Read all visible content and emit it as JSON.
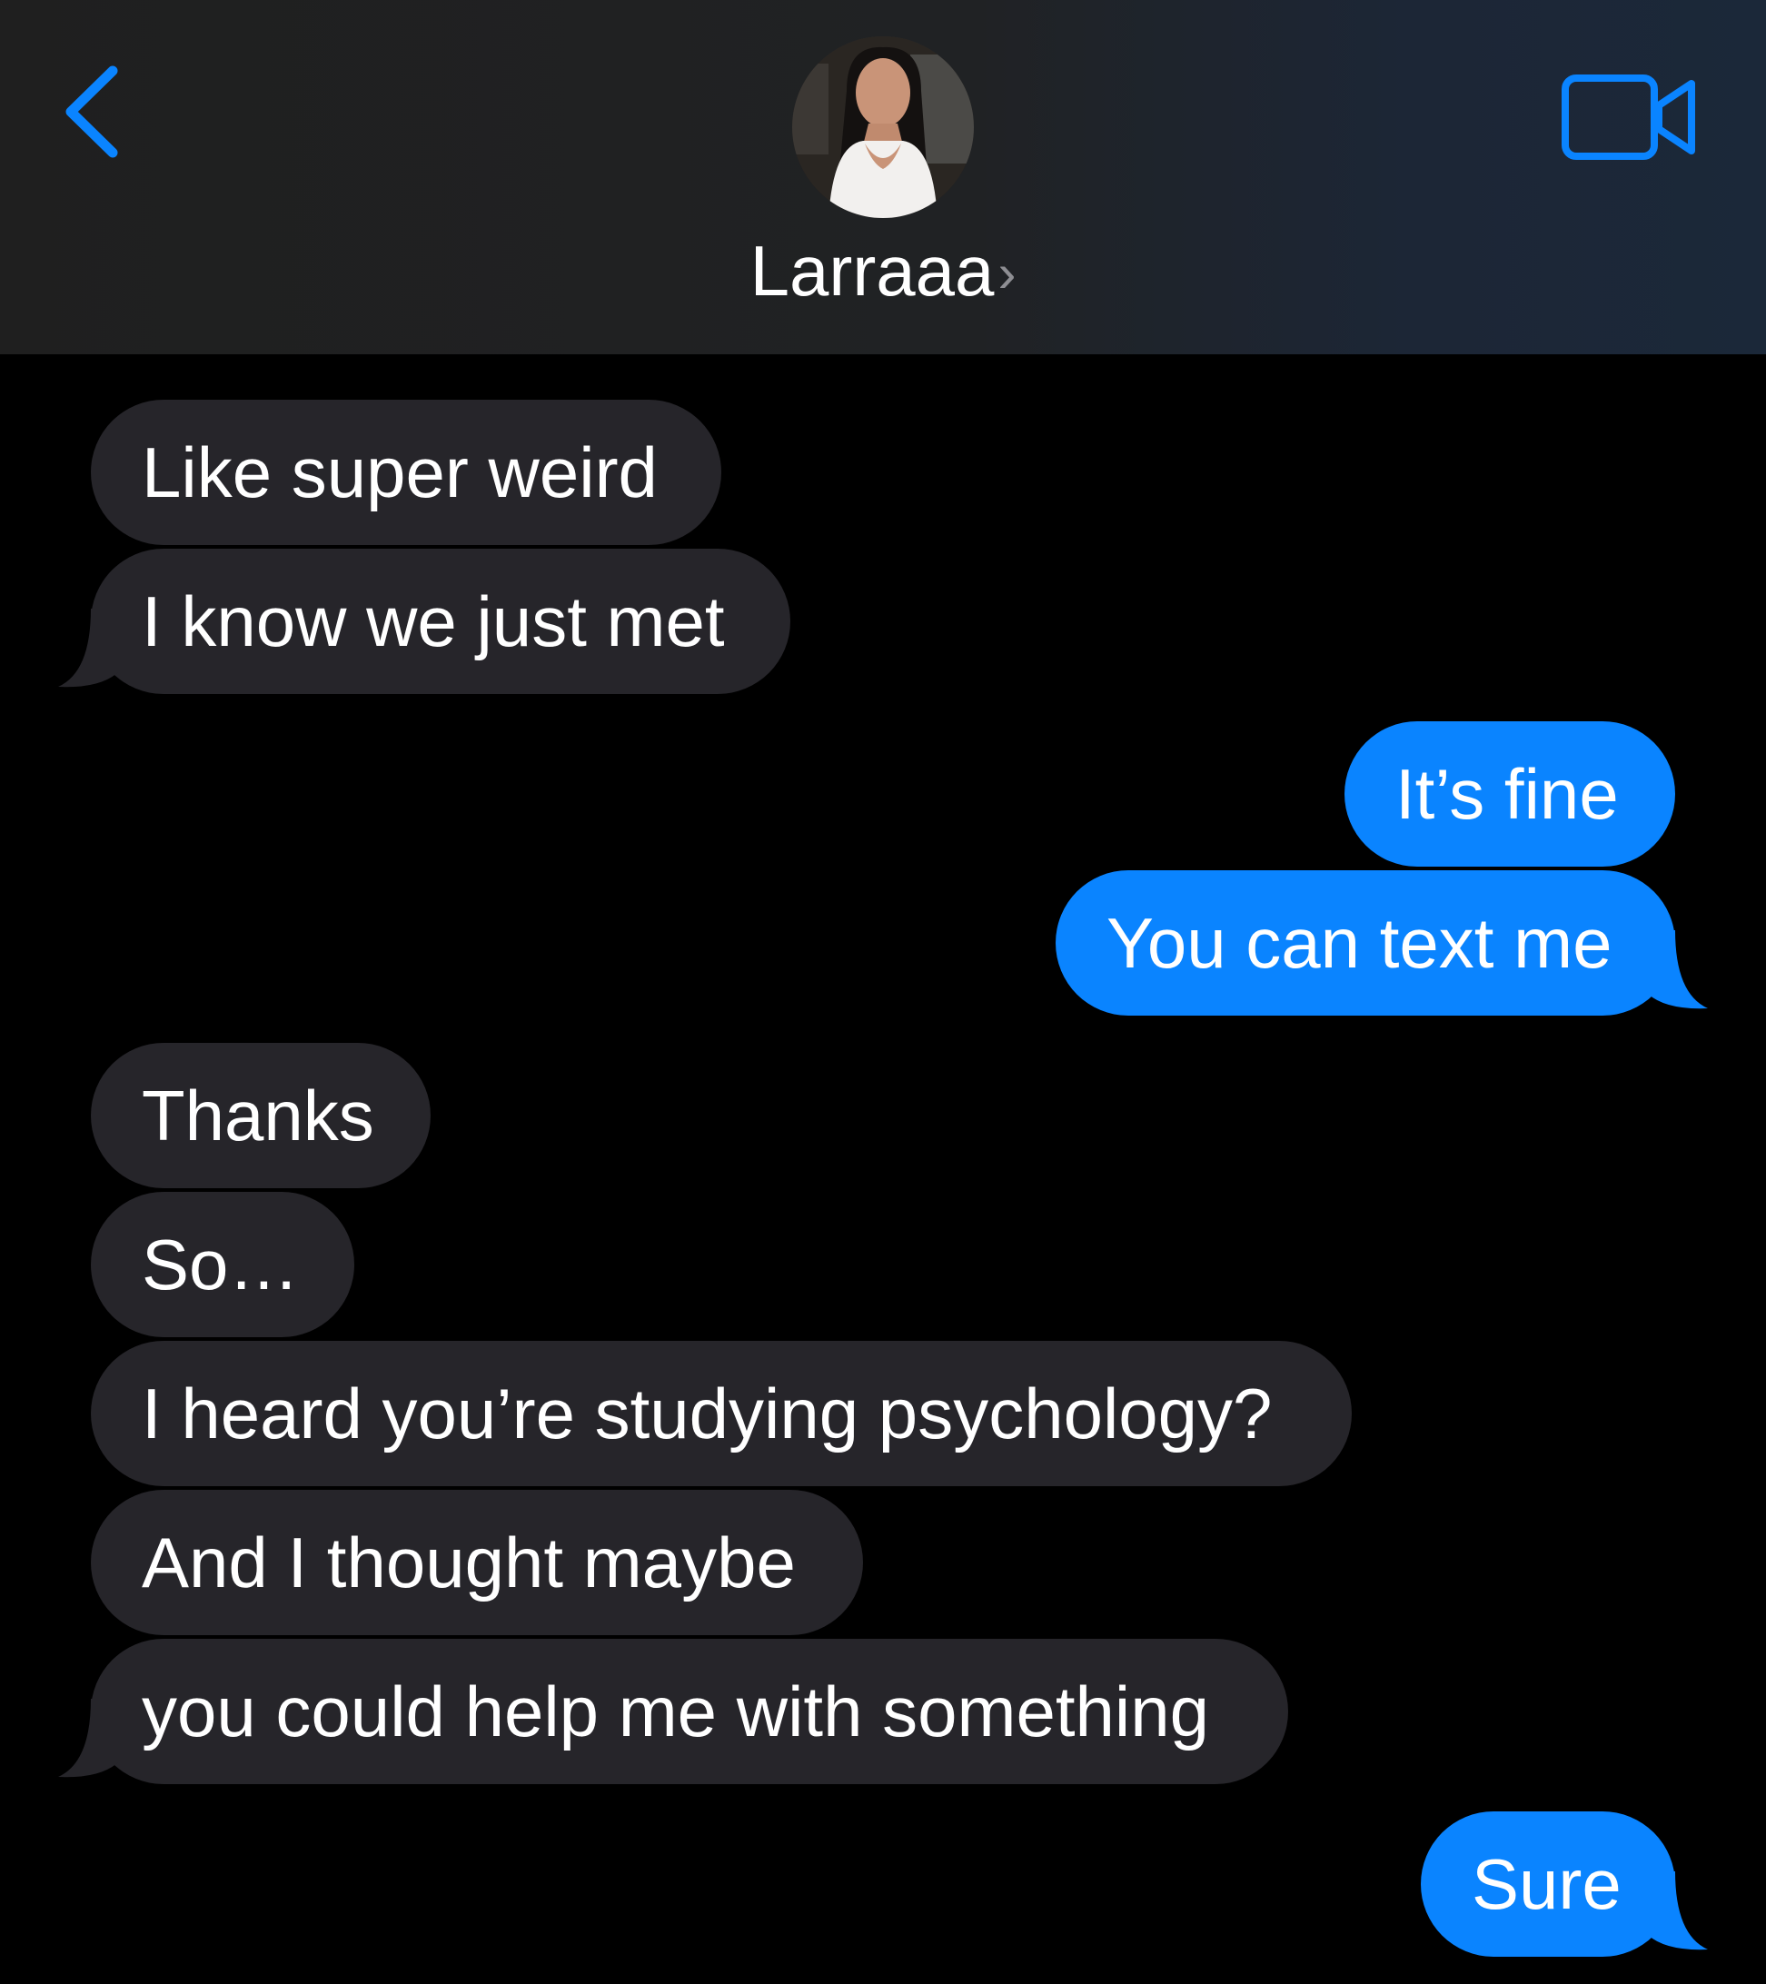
{
  "header": {
    "contact_name": "Larraaa",
    "name_chevron": "›",
    "back_icon": "chevron-left-icon",
    "video_icon": "video-camera-icon",
    "accent_color": "#0a84ff"
  },
  "messages": [
    {
      "direction": "incoming",
      "text": "Like super weird"
    },
    {
      "direction": "incoming",
      "text": "I know we just met"
    },
    {
      "direction": "outgoing",
      "text": "It’s fine"
    },
    {
      "direction": "outgoing",
      "text": "You can text me"
    },
    {
      "direction": "incoming",
      "text": "Thanks"
    },
    {
      "direction": "incoming",
      "text": "So…"
    },
    {
      "direction": "incoming",
      "text": "I heard you’re studying psychology?"
    },
    {
      "direction": "incoming",
      "text": "And I thought maybe"
    },
    {
      "direction": "incoming",
      "text": "you could help me with something"
    },
    {
      "direction": "outgoing",
      "text": "Sure"
    }
  ],
  "colors": {
    "incoming_bubble": "#26252a",
    "outgoing_bubble": "#0a84ff",
    "background": "#000000"
  }
}
